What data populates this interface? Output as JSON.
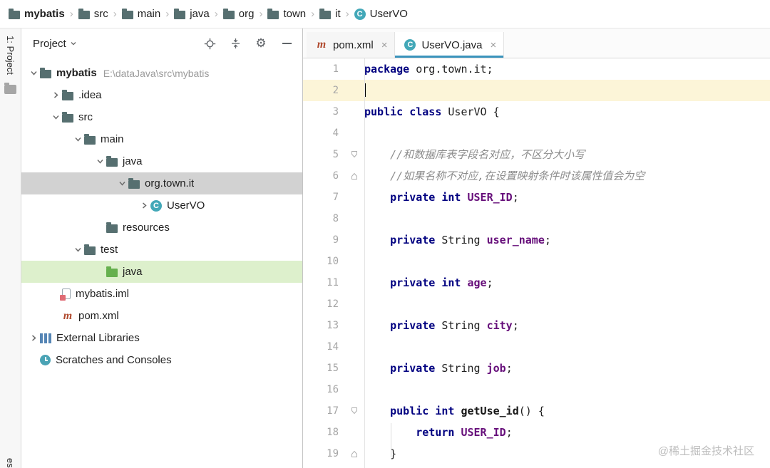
{
  "colors": {
    "accent": "#3a93bc",
    "selection-gray": "#d2d2d2",
    "selection-green": "#ddf0cc",
    "caret-line": "#fcf5d8",
    "keyword": "#000080",
    "field": "#660e7a",
    "comment": "#8c8c8c",
    "folder": "#566f70",
    "folder-green": "#66b04e",
    "class-badge": "#43a8b8",
    "maven": "#b04a2e"
  },
  "breadcrumb": {
    "items": [
      {
        "label": "mybatis",
        "icon": "folder",
        "bold": true
      },
      {
        "label": "src",
        "icon": "folder"
      },
      {
        "label": "main",
        "icon": "folder"
      },
      {
        "label": "java",
        "icon": "folder"
      },
      {
        "label": "org",
        "icon": "folder"
      },
      {
        "label": "town",
        "icon": "folder"
      },
      {
        "label": "it",
        "icon": "folder"
      },
      {
        "label": "UserVO",
        "icon": "class"
      }
    ]
  },
  "tool_window_bar": {
    "top_label": "1: Project",
    "bottom_label": "es"
  },
  "project_panel": {
    "title": "Project",
    "tree": [
      {
        "label": "mybatis",
        "suffix": "E:\\dataJava\\src\\mybatis",
        "level": 0,
        "chevron": "down",
        "icon": "folder",
        "bold": true
      },
      {
        "label": ".idea",
        "level": 1,
        "chevron": "right",
        "icon": "folder"
      },
      {
        "label": "src",
        "level": 1,
        "chevron": "down",
        "icon": "folder"
      },
      {
        "label": "main",
        "level": 2,
        "chevron": "down",
        "icon": "folder"
      },
      {
        "label": "java",
        "level": 3,
        "chevron": "down",
        "icon": "folder"
      },
      {
        "label": "org.town.it",
        "level": 4,
        "chevron": "down",
        "icon": "folder",
        "state": "selected"
      },
      {
        "label": "UserVO",
        "level": 5,
        "chevron": "right",
        "icon": "class"
      },
      {
        "label": "resources",
        "level": 3,
        "chevron": "none",
        "icon": "folder"
      },
      {
        "label": "test",
        "level": 2,
        "chevron": "down",
        "icon": "folder"
      },
      {
        "label": "java",
        "level": 3,
        "chevron": "none",
        "icon": "folder-green",
        "state": "green"
      },
      {
        "label": "mybatis.iml",
        "level": 1,
        "chevron": "none",
        "icon": "iml"
      },
      {
        "label": "pom.xml",
        "level": 1,
        "chevron": "none",
        "icon": "maven"
      },
      {
        "label": "External Libraries",
        "level": 0,
        "chevron": "right",
        "icon": "libraries"
      },
      {
        "label": "Scratches and Consoles",
        "level": 0,
        "chevron": "none",
        "icon": "scratches"
      }
    ]
  },
  "editor": {
    "tabs": [
      {
        "label": "pom.xml",
        "icon": "maven",
        "active": false
      },
      {
        "label": "UserVO.java",
        "icon": "class",
        "active": true
      }
    ],
    "code": [
      {
        "n": 1,
        "seg": [
          [
            "kw",
            "package"
          ],
          [
            "pl",
            " org.town.it;"
          ]
        ]
      },
      {
        "n": 2,
        "seg": [],
        "caret": true,
        "current": true
      },
      {
        "n": 3,
        "seg": [
          [
            "kw",
            "public class"
          ],
          [
            "pl",
            " UserVO {"
          ]
        ]
      },
      {
        "n": 4,
        "seg": []
      },
      {
        "n": 5,
        "seg": [
          [
            "cm",
            "    //和数据库表字段名对应，不区分大小写"
          ]
        ],
        "fold": "down"
      },
      {
        "n": 6,
        "seg": [
          [
            "cm",
            "    //如果名称不对应,在设置映射条件时该属性值会为空"
          ]
        ],
        "fold": "up"
      },
      {
        "n": 7,
        "seg": [
          [
            "kw",
            "    private int "
          ],
          [
            "fd",
            "USER_ID"
          ],
          [
            "pl",
            ";"
          ]
        ]
      },
      {
        "n": 8,
        "seg": []
      },
      {
        "n": 9,
        "seg": [
          [
            "kw",
            "    private "
          ],
          [
            "pl",
            "String "
          ],
          [
            "fd",
            "user_name"
          ],
          [
            "pl",
            ";"
          ]
        ]
      },
      {
        "n": 10,
        "seg": []
      },
      {
        "n": 11,
        "seg": [
          [
            "kw",
            "    private int "
          ],
          [
            "fd",
            "age"
          ],
          [
            "pl",
            ";"
          ]
        ]
      },
      {
        "n": 12,
        "seg": []
      },
      {
        "n": 13,
        "seg": [
          [
            "kw",
            "    private "
          ],
          [
            "pl",
            "String "
          ],
          [
            "fd",
            "city"
          ],
          [
            "pl",
            ";"
          ]
        ]
      },
      {
        "n": 14,
        "seg": []
      },
      {
        "n": 15,
        "seg": [
          [
            "kw",
            "    private "
          ],
          [
            "pl",
            "String "
          ],
          [
            "fd",
            "job"
          ],
          [
            "pl",
            ";"
          ]
        ]
      },
      {
        "n": 16,
        "seg": []
      },
      {
        "n": 17,
        "seg": [
          [
            "kw",
            "    public int "
          ],
          [
            "mt",
            "getUse_id"
          ],
          [
            "pl",
            "() {"
          ]
        ],
        "fold": "down"
      },
      {
        "n": 18,
        "seg": [
          [
            "kw",
            "        return "
          ],
          [
            "fd",
            "USER_ID"
          ],
          [
            "pl",
            ";"
          ]
        ]
      },
      {
        "n": 19,
        "seg": [
          [
            "pl",
            "    }"
          ]
        ],
        "fold": "up"
      }
    ],
    "watermark": "@稀土掘金技术社区"
  }
}
